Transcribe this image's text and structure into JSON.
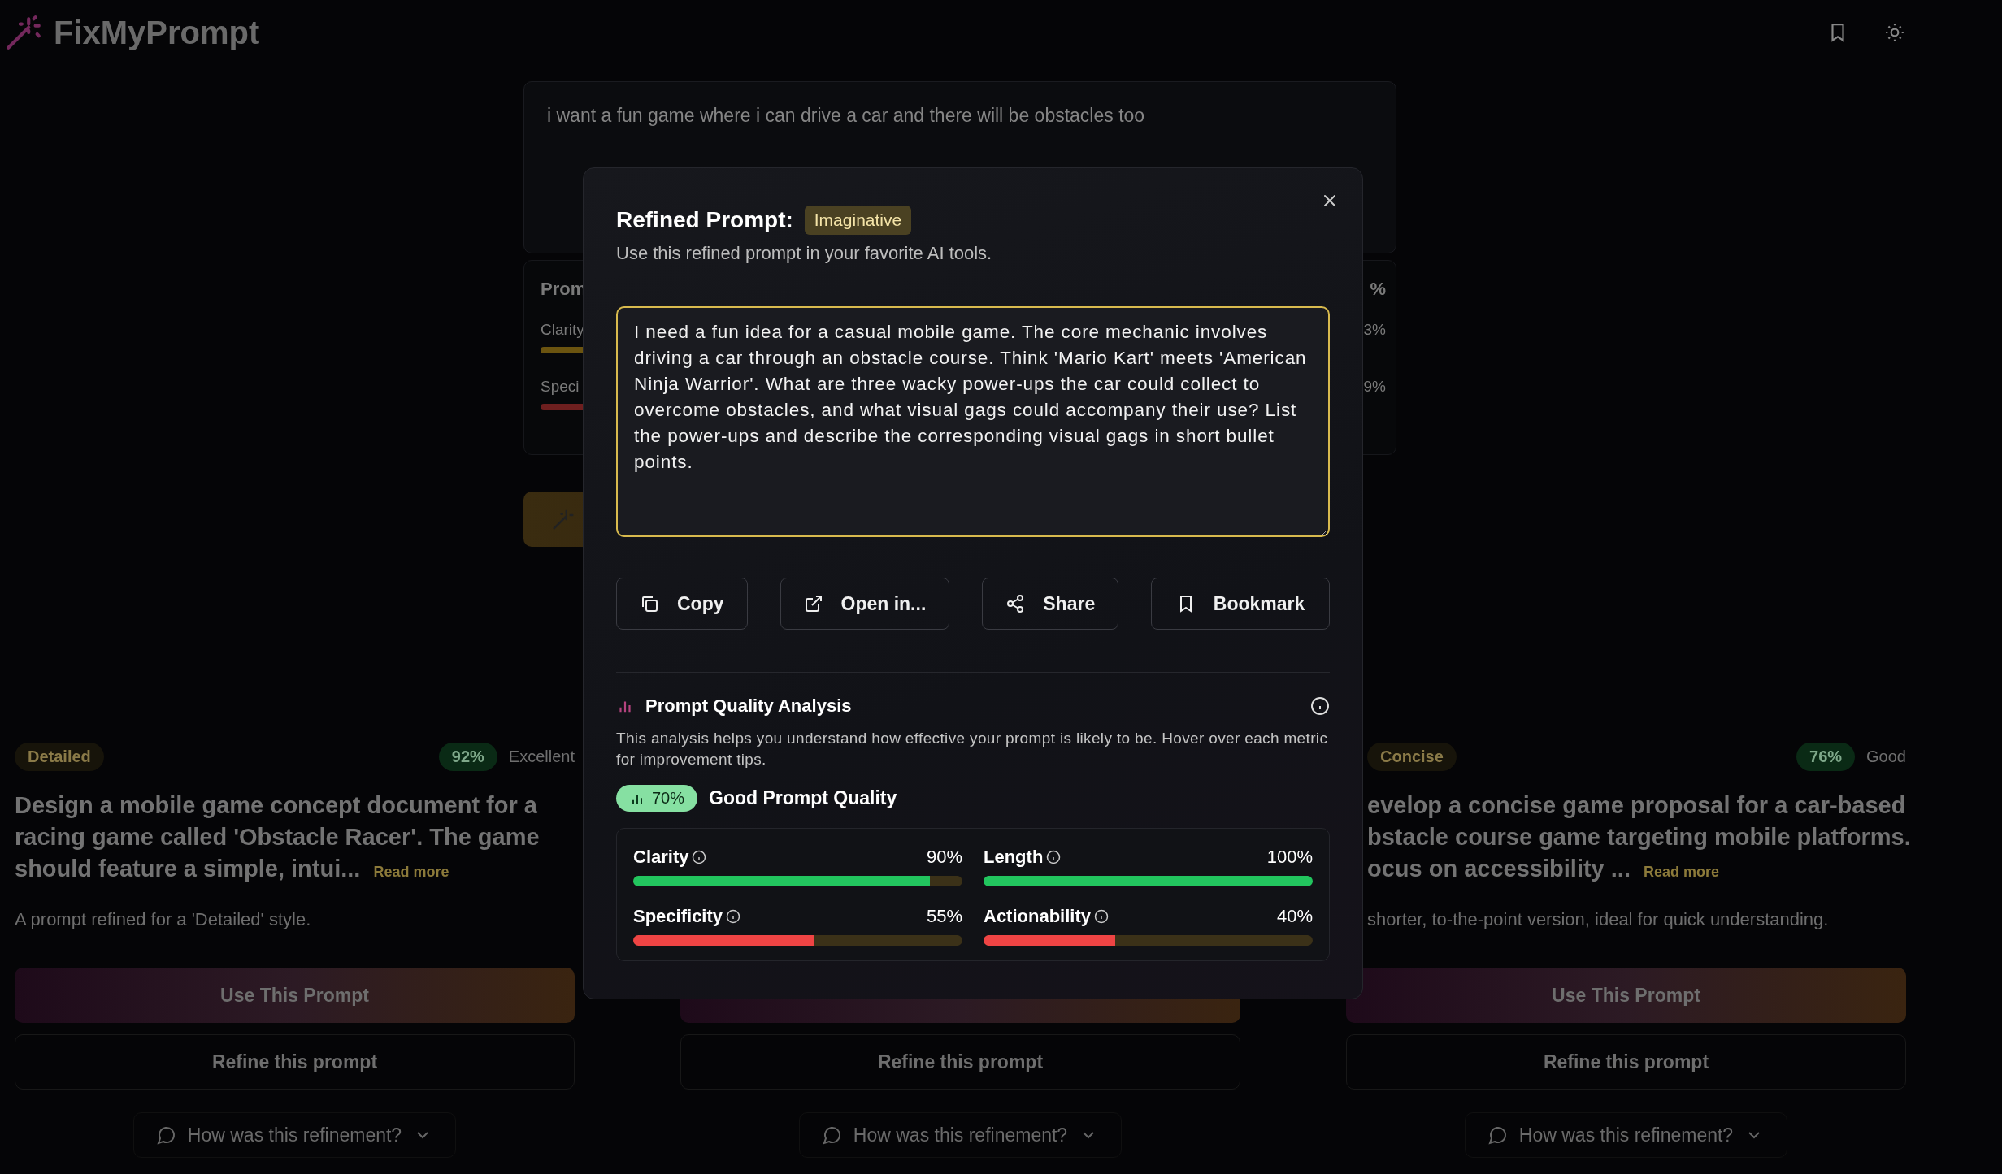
{
  "header": {
    "logo_text": "FixMyPrompt"
  },
  "input": {
    "value": "i want a fun game where i can drive a car and there will be obstacles too"
  },
  "background_analysis": {
    "title": "Prom",
    "score": "%",
    "metrics": [
      {
        "label": "Clarity",
        "reading": "3%",
        "color": "#6b5410"
      },
      {
        "label": "Speci",
        "reading": "9%",
        "color": "#6e1f1f"
      }
    ]
  },
  "cards": [
    {
      "tag": "Detailed",
      "score": "92%",
      "rating": "Excellent",
      "title_lines": [
        "Design a mobile game concept document for a",
        "racing game called 'Obstacle Racer'. The game",
        "should feature a simple, intui..."
      ],
      "read_more": "Read more",
      "description": "A prompt refined for a 'Detailed' style.",
      "use_label": "Use This Prompt",
      "refine_label": "Refine this prompt",
      "feedback_label": "How was this refinement?"
    },
    {
      "refine_label": "Refine this prompt",
      "feedback_label": "How was this refinement?"
    },
    {
      "tag": "Concise",
      "score": "76%",
      "rating": "Good",
      "title_lines": [
        "evelop a concise game proposal for a car-based",
        "bstacle course game targeting mobile platforms.",
        "ocus on accessibility ..."
      ],
      "read_more": "Read more",
      "description": "shorter, to-the-point version, ideal for quick understanding.",
      "use_label": "Use This Prompt",
      "refine_label": "Refine this prompt",
      "feedback_label": "How was this refinement?"
    }
  ],
  "modal": {
    "title": "Refined Prompt:",
    "style_badge": "Imaginative",
    "subtitle": "Use this refined prompt in your favorite AI tools.",
    "prompt_text": "I need a fun idea for a casual mobile game. The core mechanic involves driving a car through an obstacle course. Think 'Mario Kart' meets 'American Ninja Warrior'. What are three wacky power-ups the car could collect to overcome obstacles, and what visual gags could accompany their use? List the power-ups and describe the corresponding visual gags in short bullet points.",
    "actions": [
      {
        "label": "Copy",
        "kind": "copy"
      },
      {
        "label": "Open in...",
        "kind": "open"
      },
      {
        "label": "Share",
        "kind": "share"
      },
      {
        "label": "Bookmark",
        "kind": "bookmark"
      }
    ],
    "analysis": {
      "title": "Prompt Quality Analysis",
      "description": "This analysis helps you understand how effective your prompt is likely to be. Hover over each metric for improvement tips.",
      "score": "70%",
      "verdict": "Good Prompt Quality",
      "metrics": [
        {
          "label": "Clarity",
          "reading": "90%",
          "level": 0.9,
          "color": "#22c55e"
        },
        {
          "label": "Length",
          "reading": "100%",
          "level": 1.0,
          "color": "#22c55e"
        },
        {
          "label": "Specificity",
          "reading": "55%",
          "level": 0.55,
          "color": "#ef4444"
        },
        {
          "label": "Actionability",
          "reading": "40%",
          "level": 0.4,
          "color": "#ef4444"
        }
      ]
    }
  }
}
